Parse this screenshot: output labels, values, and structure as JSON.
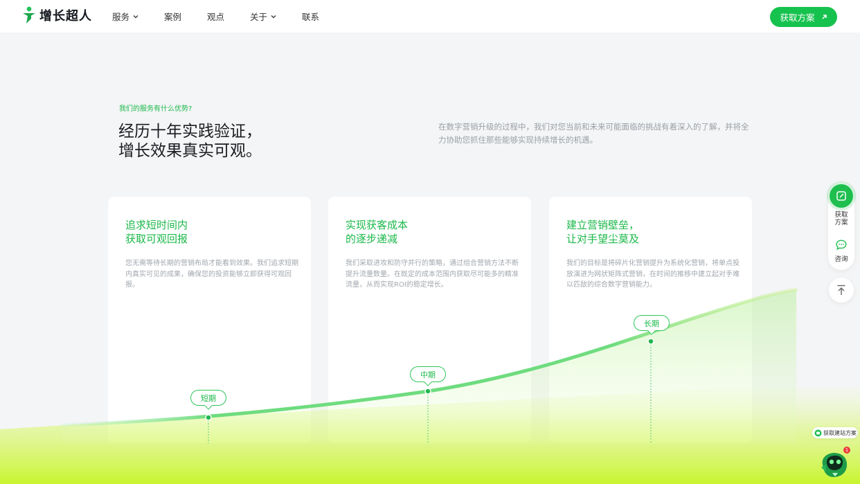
{
  "brand": {
    "name": "增长超人",
    "color": "#16c24e"
  },
  "nav": {
    "items": [
      {
        "label": "服务",
        "has_dropdown": true
      },
      {
        "label": "案例",
        "has_dropdown": false
      },
      {
        "label": "观点",
        "has_dropdown": false
      },
      {
        "label": "关于",
        "has_dropdown": true
      },
      {
        "label": "联系",
        "has_dropdown": false
      }
    ],
    "cta_label": "获取方案",
    "cta_icon": "arrow-up-right-icon"
  },
  "intro": {
    "eyebrow": "我们的服务有什么优势?",
    "headline_line1": "经历十年实践验证，",
    "headline_line2": "增长效果真实可观。",
    "description": "在数字营销升级的过程中，我们对您当前和未来可能面临的挑战有着深入的了解，并将全力协助您抓住那些能够实现持续增长的机遇。"
  },
  "cards": [
    {
      "title_line1": "追求短时间内",
      "title_line2": "获取可观回报",
      "description": "您无需等待长期的营销布局才能看到效果。我们追求短期内真实可见的成果，确保您的投资能够立即获得可观回报。",
      "marker": "短期"
    },
    {
      "title_line1": "实现获客成本",
      "title_line2": "的逐步递减",
      "description": "我们采取进攻和防守并行的策略，通过组合营销方法不断提升流量数量。在既定的成本范围内获取尽可能多的精准流量，从而实现ROI的稳定增长。",
      "marker": "中期"
    },
    {
      "title_line1": "建立营销壁垒，",
      "title_line2": "让对手望尘莫及",
      "description": "我们的目标是将碎片化营销提升为系统化营销，将单点投放演进为网状矩阵式营销，在时间的推移中建立起对手难以匹敌的综合数字营销能力。",
      "marker": "长期"
    }
  ],
  "sidebar": {
    "items": [
      {
        "label_line1": "获取",
        "label_line2": "方案",
        "icon": "edit-note-icon"
      },
      {
        "label_line1": "咨询",
        "label_line2": "",
        "icon": "chat-bubble-icon"
      }
    ],
    "back_to_top_icon": "arrow-up-to-top-icon"
  },
  "chat_widget": {
    "pill_label": "获取建站方案",
    "badge_count": "1"
  }
}
